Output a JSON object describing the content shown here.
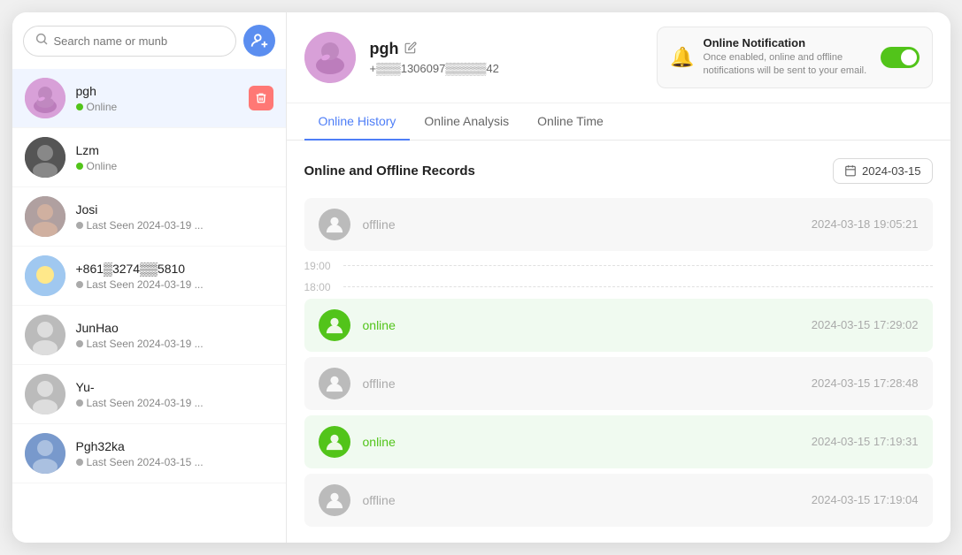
{
  "search": {
    "placeholder": "Search name or munb"
  },
  "contacts": [
    {
      "id": "pgh",
      "name": "pgh",
      "status": "Online",
      "status_type": "online",
      "active": true,
      "has_delete": true,
      "avatar_type": "pgh_avatar"
    },
    {
      "id": "lzm",
      "name": "Lzm",
      "status": "Online",
      "status_type": "online",
      "active": false,
      "has_delete": false,
      "avatar_type": "lzm_avatar"
    },
    {
      "id": "josi",
      "name": "Josi",
      "status": "Last Seen 2024-03-19 ...",
      "status_type": "offline",
      "active": false,
      "has_delete": false,
      "avatar_type": "josi_avatar"
    },
    {
      "id": "phone",
      "name": "+861▒3274▒▒5810",
      "status": "Last Seen 2024-03-19 ...",
      "status_type": "offline",
      "active": false,
      "has_delete": false,
      "avatar_type": "phone_avatar"
    },
    {
      "id": "junhao",
      "name": "JunHao",
      "status": "Last Seen 2024-03-19 ...",
      "status_type": "offline",
      "active": false,
      "has_delete": false,
      "avatar_type": "default_avatar"
    },
    {
      "id": "yu",
      "name": "Yu-",
      "status": "Last Seen 2024-03-19 ...",
      "status_type": "offline",
      "active": false,
      "has_delete": false,
      "avatar_type": "default_avatar"
    },
    {
      "id": "pgh32ka",
      "name": "Pgh32ka",
      "status": "Last Seen 2024-03-15 ...",
      "status_type": "offline",
      "active": false,
      "has_delete": false,
      "avatar_type": "pgh32ka_avatar"
    }
  ],
  "profile": {
    "name": "pgh",
    "phone": "+▒▒▒1306097▒▒▒▒▒42"
  },
  "notification": {
    "title": "Online Notification",
    "description": "Once enabled, online and offline notifications will be sent to your email.",
    "enabled": true
  },
  "tabs": [
    {
      "id": "history",
      "label": "Online History",
      "active": true
    },
    {
      "id": "analysis",
      "label": "Online Analysis",
      "active": false
    },
    {
      "id": "time",
      "label": "Online Time",
      "active": false
    }
  ],
  "records_section": {
    "title": "Online and Offline Records",
    "date": "2024-03-15"
  },
  "time_labels": [
    {
      "label": "19:00"
    },
    {
      "label": "18:00"
    }
  ],
  "records": [
    {
      "type": "offline",
      "status_label": "offline",
      "timestamp": "2024-03-18 19:05:21"
    },
    {
      "type": "online",
      "status_label": "online",
      "timestamp": "2024-03-15 17:29:02"
    },
    {
      "type": "offline",
      "status_label": "offline",
      "timestamp": "2024-03-15 17:28:48"
    },
    {
      "type": "online",
      "status_label": "online",
      "timestamp": "2024-03-15 17:19:31"
    },
    {
      "type": "offline",
      "status_label": "offline",
      "timestamp": "2024-03-15 17:19:04"
    }
  ]
}
